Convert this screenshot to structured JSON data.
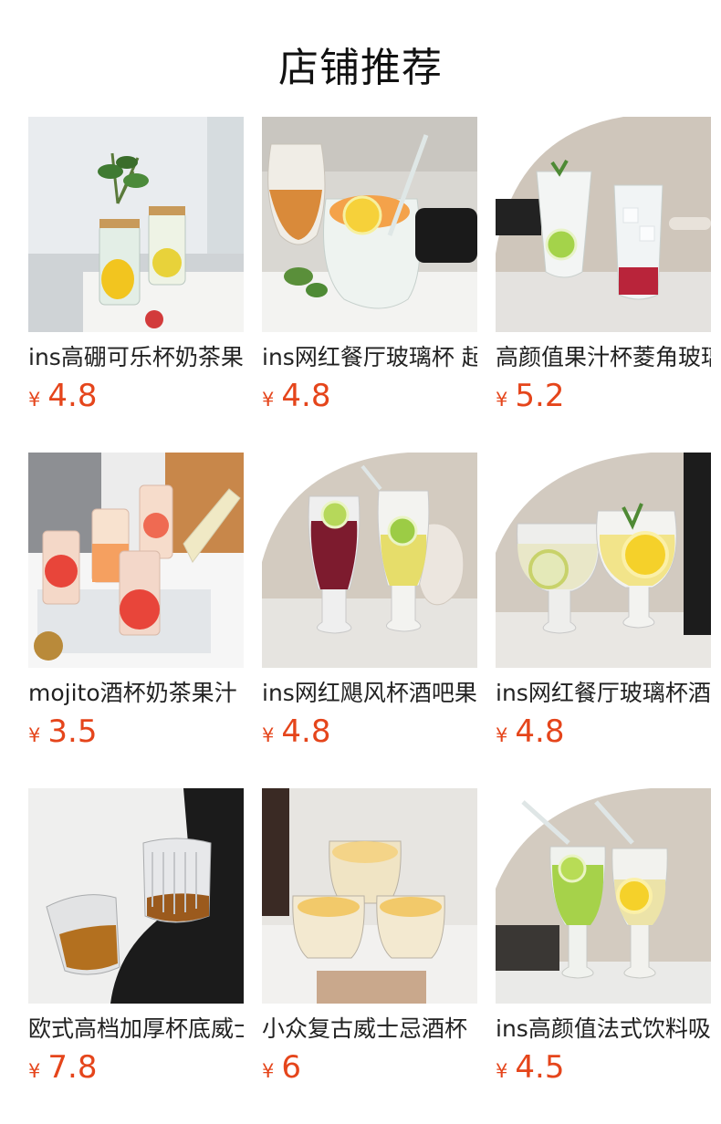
{
  "page": {
    "title": "店铺推荐"
  },
  "products": [
    {
      "name": "ins高硼可乐杯奶茶果",
      "currency": "¥",
      "price": "4.8",
      "image": "glass-jar-lemon-drinks"
    },
    {
      "name": "ins网红餐厅玻璃杯 起",
      "currency": "¥",
      "price": "4.8",
      "image": "goblet-orange-drink"
    },
    {
      "name": "高颜值果汁杯菱角玻璃",
      "currency": "¥",
      "price": "5.2",
      "image": "ice-lime-tall-glasses"
    },
    {
      "name": "mojito酒杯奶茶果汁",
      "currency": "¥",
      "price": "3.5",
      "image": "grapefruit-mojito-glasses"
    },
    {
      "name": "ins网红飓风杯酒吧果",
      "currency": "¥",
      "price": "4.8",
      "image": "hurricane-glasses"
    },
    {
      "name": "ins网红餐厅玻璃杯酒",
      "currency": "¥",
      "price": "4.8",
      "image": "stemmed-lemon-glasses"
    },
    {
      "name": "欧式高档加厚杯底威士",
      "currency": "¥",
      "price": "7.8",
      "image": "crystal-whisky-glasses"
    },
    {
      "name": "小众复古威士忌酒杯",
      "currency": "¥",
      "price": "6",
      "image": "vintage-whisky-glasses"
    },
    {
      "name": "ins高颜值法式饮料吸",
      "currency": "¥",
      "price": "4.5",
      "image": "french-drink-glasses"
    }
  ],
  "colors": {
    "price": "#e5451b",
    "title": "#111111"
  }
}
